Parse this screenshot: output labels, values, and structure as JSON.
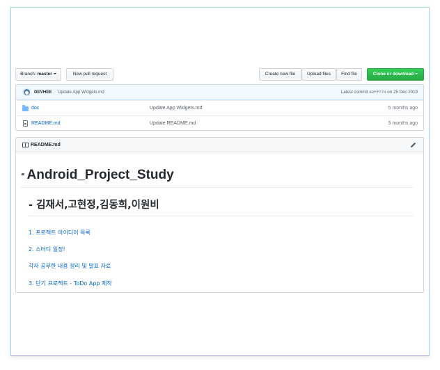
{
  "toolbar": {
    "branch_label": "Branch:",
    "branch_value": "master",
    "new_pull_request": "New pull request",
    "create_new_file": "Create new file",
    "upload_files": "Upload files",
    "find_file": "Find file",
    "clone_or_download": "Clone or download"
  },
  "commit": {
    "author": "DEVHEE",
    "message": "Update App Widgets.md",
    "latest_prefix": "Latest commit",
    "hash": "02ff771",
    "date": "on 25 Dec 2019"
  },
  "files": [
    {
      "name": "doc",
      "type": "folder",
      "message": "Update App Widgets.md",
      "age": "5 months ago"
    },
    {
      "name": "README.md",
      "type": "file",
      "message": "Update README.md",
      "age": "5 months ago"
    }
  ],
  "readme": {
    "header": "README.md",
    "h1": "Android_Project_Study",
    "h2": "- 김재서,고현정,김동희,이원비",
    "links": [
      "1. 프로젝트 아이디어 목록",
      "2. 스터디 일정!",
      "각자 공부한 내용 정리 및 발표 자료",
      "3. 단기 프로젝트 - ToDo App 제작"
    ]
  },
  "colors": {
    "link": "#0366d6",
    "green_button": "#28a745",
    "commit_bar": "#f1f8ff"
  }
}
